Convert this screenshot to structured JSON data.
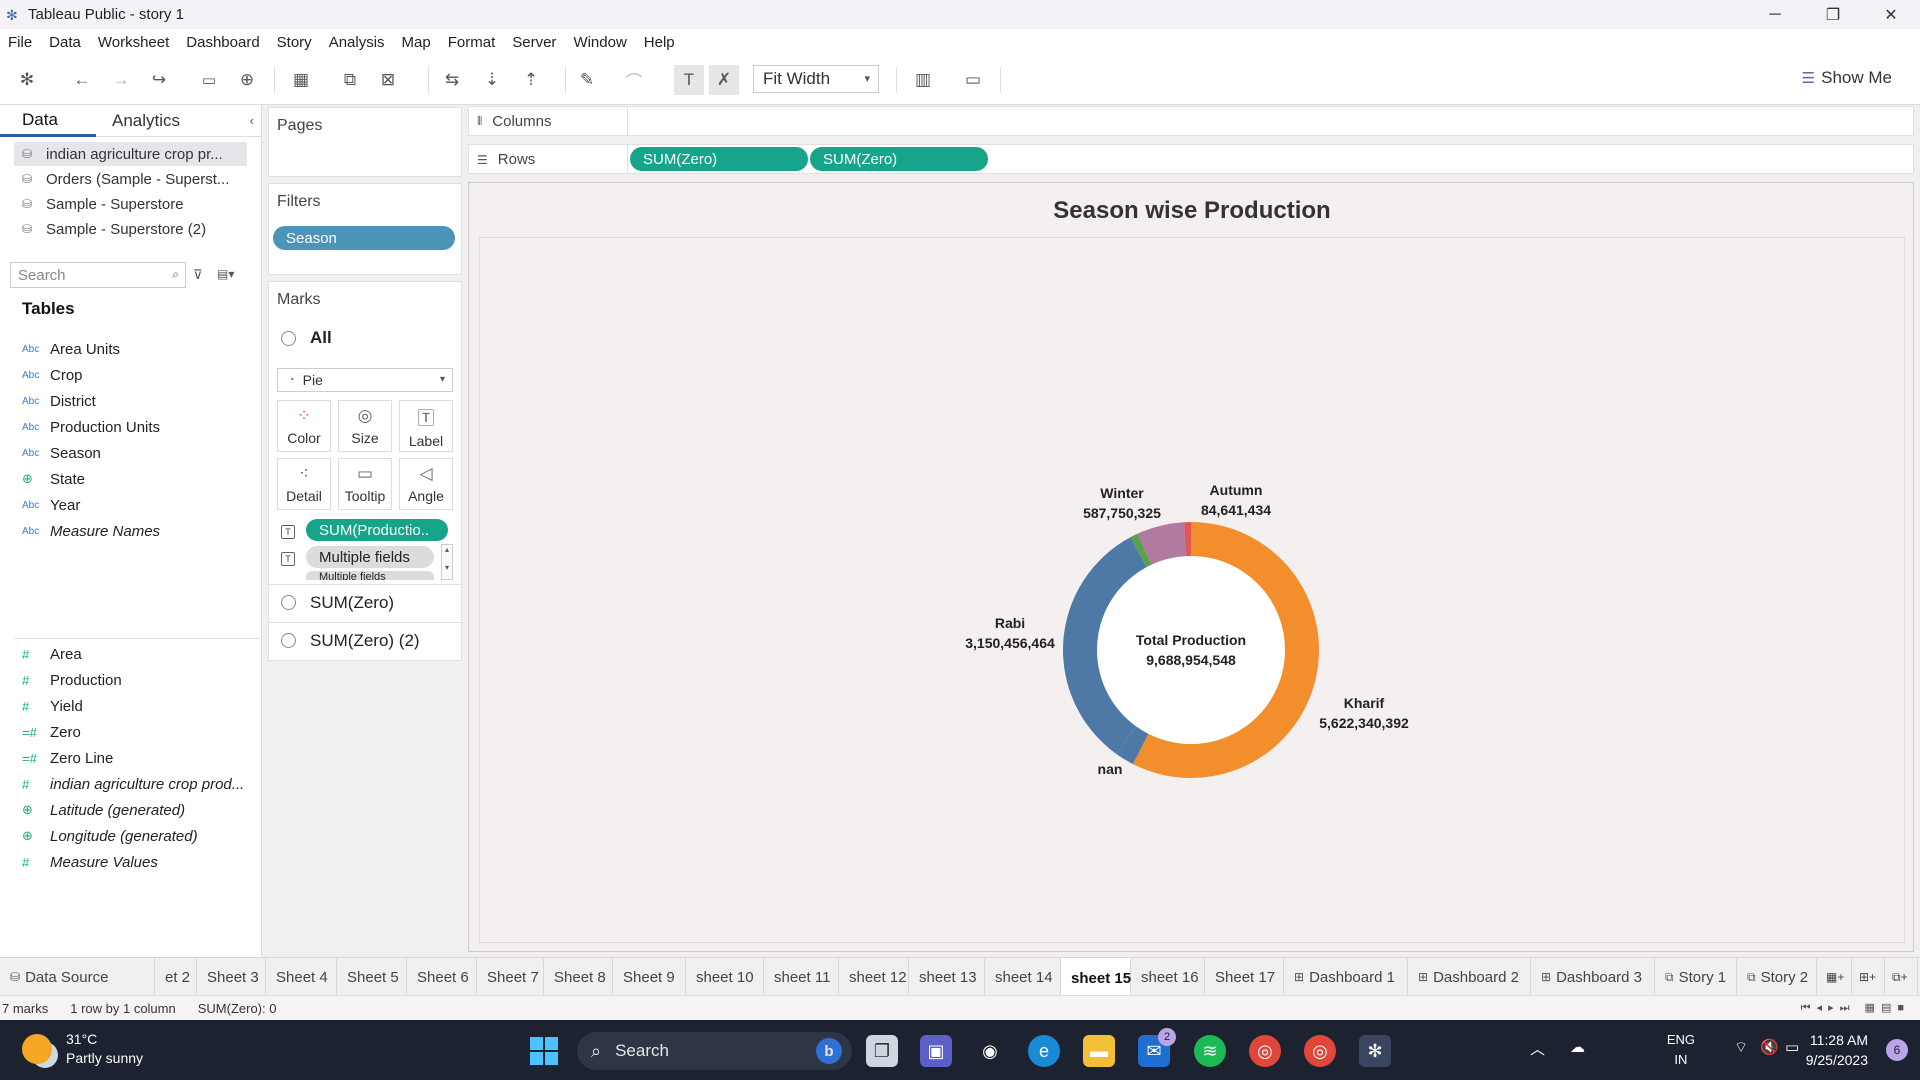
{
  "window": {
    "title": "Tableau Public - story 1"
  },
  "menu": [
    "File",
    "Data",
    "Worksheet",
    "Dashboard",
    "Story",
    "Analysis",
    "Map",
    "Format",
    "Server",
    "Window",
    "Help"
  ],
  "toolbar": {
    "fit_label": "Fit Width",
    "show_me": "Show Me"
  },
  "data_pane": {
    "tab_data": "Data",
    "tab_analytics": "Analytics",
    "sources": [
      "indian agriculture crop pr...",
      "Orders (Sample - Superst...",
      "Sample - Superstore",
      "Sample - Superstore (2)"
    ],
    "search_placeholder": "Search",
    "tables_heading": "Tables",
    "dimensions": [
      {
        "icon": "Abc",
        "name": "Area Units"
      },
      {
        "icon": "Abc",
        "name": "Crop"
      },
      {
        "icon": "Abc",
        "name": "District"
      },
      {
        "icon": "Abc",
        "name": "Production Units"
      },
      {
        "icon": "Abc",
        "name": "Season"
      },
      {
        "icon": "globe",
        "name": "State"
      },
      {
        "icon": "Abc",
        "name": "Year"
      },
      {
        "icon": "Abc",
        "name": "Measure Names"
      }
    ],
    "measures": [
      {
        "icon": "#",
        "name": "Area"
      },
      {
        "icon": "#",
        "name": "Production"
      },
      {
        "icon": "#",
        "name": "Yield"
      },
      {
        "icon": "=#",
        "name": "Zero"
      },
      {
        "icon": "=#",
        "name": "Zero Line"
      },
      {
        "icon": "#",
        "name": "indian agriculture crop prod..."
      },
      {
        "icon": "globe",
        "name": "Latitude (generated)"
      },
      {
        "icon": "globe",
        "name": "Longitude (generated)"
      },
      {
        "icon": "#",
        "name": "Measure Values"
      }
    ]
  },
  "pages": {
    "label": "Pages"
  },
  "filters": {
    "label": "Filters",
    "pills": [
      "Season"
    ]
  },
  "marks": {
    "label": "Marks",
    "all": "All",
    "mark_type": "Pie",
    "buttons": [
      "Color",
      "Size",
      "Label",
      "Detail",
      "Tooltip",
      "Angle"
    ],
    "shelf_pills": [
      "SUM(Productio..",
      "Multiple fields",
      "Multiple fields"
    ],
    "layers": [
      "SUM(Zero)",
      "SUM(Zero) (2)"
    ]
  },
  "shelves": {
    "columns_label": "Columns",
    "rows_label": "Rows",
    "rows_pills": [
      "SUM(Zero)",
      "SUM(Zero)"
    ]
  },
  "chart_data": {
    "type": "pie",
    "title": "Season wise Production",
    "center_label": "Total Production",
    "center_value": "9,688,954,548",
    "slices": [
      {
        "name": "Kharif",
        "label_value": "5,622,340,392",
        "value": 5622340392,
        "color": "#f28e2b"
      },
      {
        "name": "nan",
        "label_value": "",
        "value": 240000000,
        "color": "#4e79a7"
      },
      {
        "name": "Rabi",
        "label_value": "3,150,456,464",
        "value": 3150456464,
        "color": "#4e79a7"
      },
      {
        "name": "",
        "label_value": "",
        "value": 95000000,
        "color": "#59a14f"
      },
      {
        "name": "Winter",
        "label_value": "587,750,325",
        "value": 587750325,
        "color": "#b07aa1"
      },
      {
        "name": "Autumn",
        "label_value": "84,641,434",
        "value": 84641434,
        "color": "#e15759"
      }
    ]
  },
  "sheet_tabs": [
    "Data Source",
    "et 2",
    "Sheet 3",
    "Sheet 4",
    "Sheet 5",
    "Sheet 6",
    "Sheet 7",
    "Sheet 8",
    "Sheet 9",
    "sheet 10",
    "sheet 11",
    "sheet 12",
    "sheet 13",
    "sheet 14",
    "sheet 15",
    "sheet 16",
    "Sheet 17",
    "Dashboard 1",
    "Dashboard 2",
    "Dashboard 3",
    "Story 1",
    "Story 2"
  ],
  "active_tab": "sheet 15",
  "status": {
    "marks": "7 marks",
    "dims": "1 row by 1 column",
    "sum": "SUM(Zero): 0"
  },
  "taskbar": {
    "temp": "31°C",
    "weather": "Partly sunny",
    "search": "Search",
    "lang1": "ENG",
    "lang2": "IN",
    "time": "11:28 AM",
    "date": "9/25/2023",
    "notif_count": "6",
    "mail_badge": "2"
  }
}
